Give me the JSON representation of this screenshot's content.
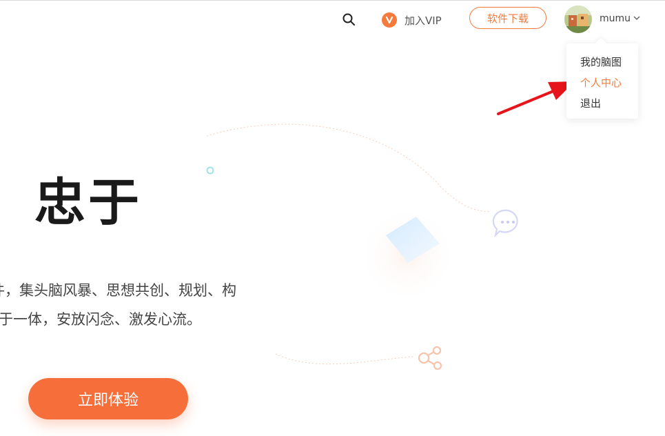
{
  "header": {
    "vip_label": "加入VIP",
    "download_label": "软件下载",
    "username": "mumu"
  },
  "dropdown": {
    "items": [
      {
        "label": "我的脑图"
      },
      {
        "label": "个人中心"
      },
      {
        "label": "退出"
      }
    ]
  },
  "hero": {
    "title": "忠于",
    "line1": "件，集头脑风暴、思想共创、规划、构",
    "line2": "于一体，安放闪念、激发心流。",
    "cta_label": "立即体验"
  },
  "colors": {
    "accent": "#f47b3c",
    "cta": "#f66f3a",
    "arrow": "#e8141b"
  },
  "icons": [
    "search-icon",
    "vip-icon",
    "chevron-down-icon",
    "chat-bubble-icon",
    "share-icon"
  ]
}
